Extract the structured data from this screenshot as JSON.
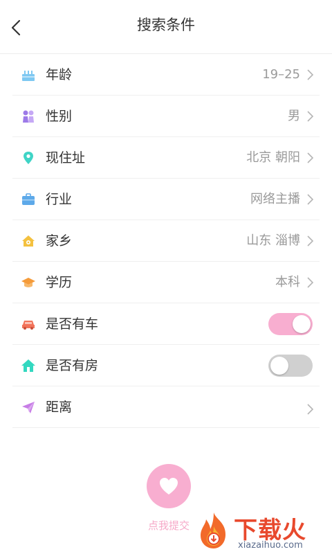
{
  "header": {
    "title": "搜索条件"
  },
  "rows": [
    {
      "label": "年龄",
      "value": "19–25"
    },
    {
      "label": "性别",
      "value": "男"
    },
    {
      "label": "现住址",
      "value": "北京 朝阳"
    },
    {
      "label": "行业",
      "value": "网络主播"
    },
    {
      "label": "家乡",
      "value": "山东 淄博"
    },
    {
      "label": "学历",
      "value": "本科"
    },
    {
      "label": "是否有车",
      "toggle": true
    },
    {
      "label": "是否有房",
      "toggle": false
    },
    {
      "label": "距离",
      "value": ""
    }
  ],
  "submit": {
    "label": "点我提交"
  },
  "watermark": {
    "brand": "下载火",
    "site": "xiazaihuo.com"
  },
  "colors": {
    "accent": "#f8aed0",
    "toggle_off": "#d0d0d0"
  }
}
